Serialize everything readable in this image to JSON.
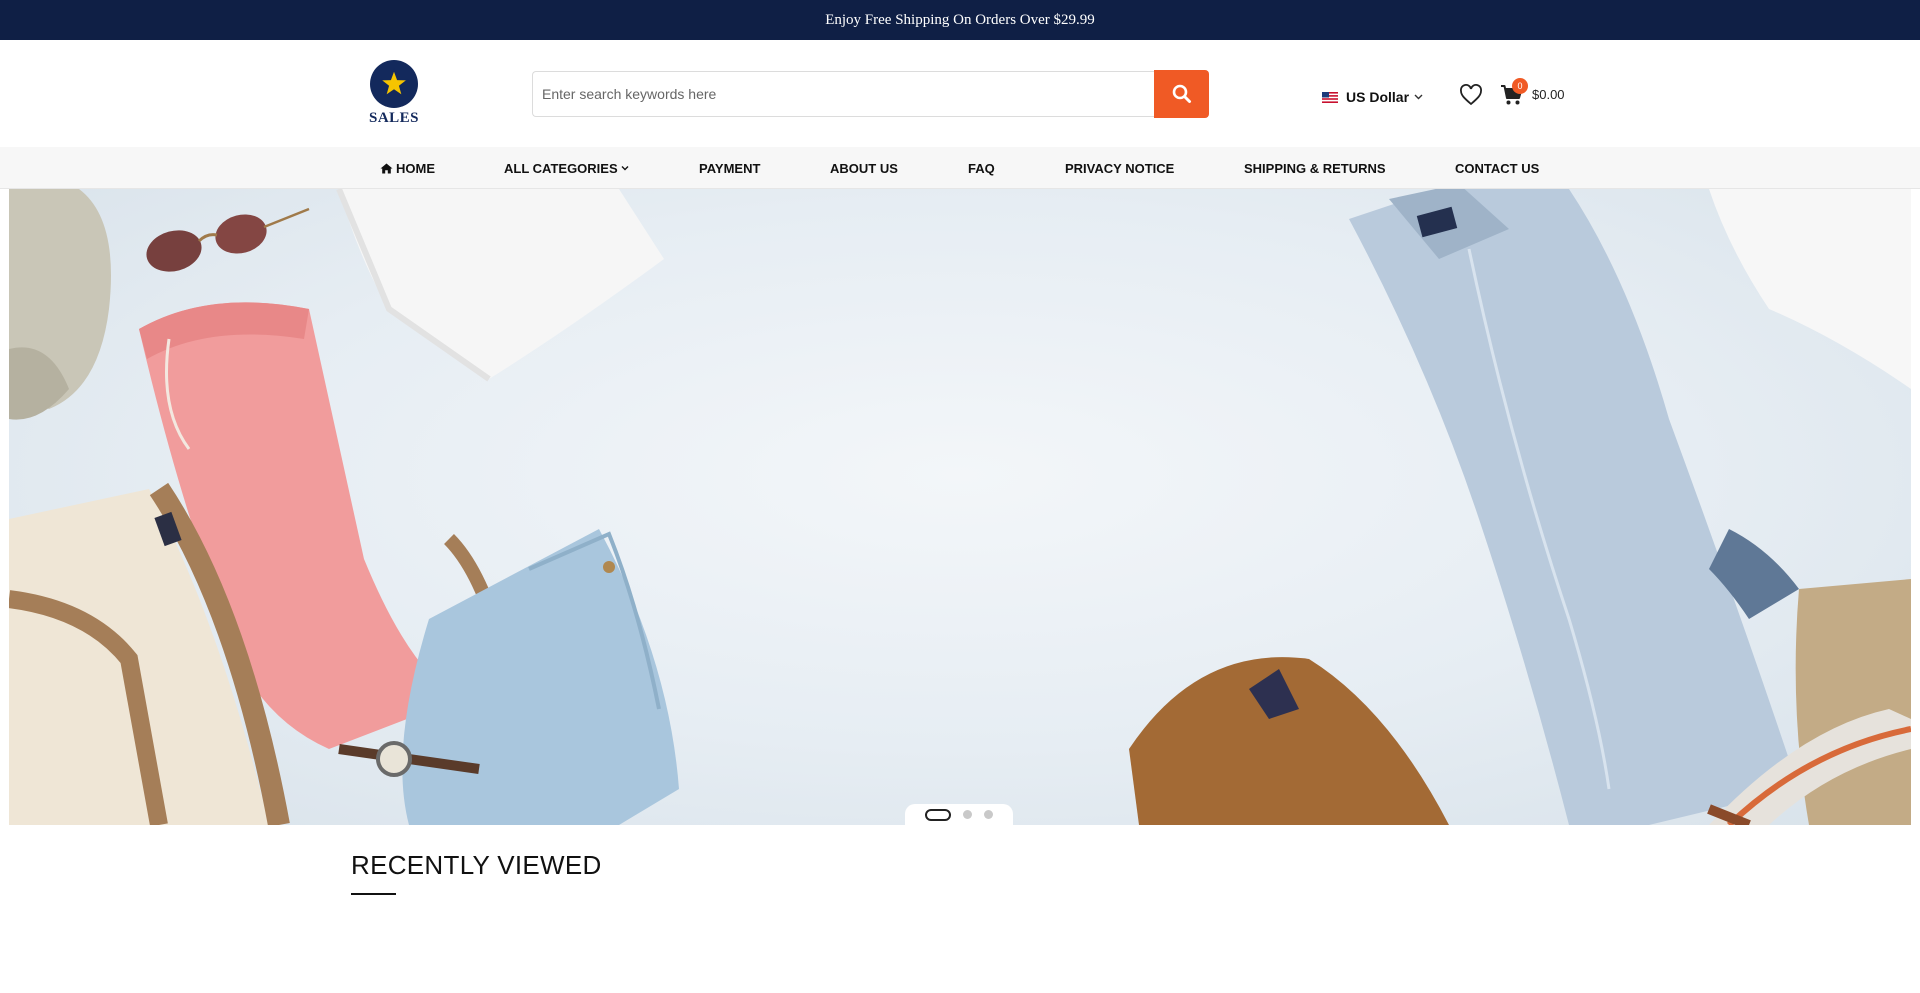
{
  "topbar": {
    "text": "Enjoy Free Shipping On Orders Over $29.99"
  },
  "logo": {
    "text": "SALES"
  },
  "search": {
    "placeholder": "Enter search keywords here"
  },
  "currency": {
    "label": "US Dollar",
    "flag_icon": "us-flag-icon"
  },
  "cart": {
    "count": "0",
    "total": "$0.00"
  },
  "nav": {
    "home": "HOME",
    "categories": "ALL CATEGORIES",
    "payment": "PAYMENT",
    "about": "ABOUT US",
    "faq": "FAQ",
    "privacy": "PRIVACY NOTICE",
    "shipping": "SHIPPING & RETURNS",
    "contact": "CONTACT US"
  },
  "carousel": {
    "slides": 3,
    "active_slide": 1
  },
  "recently_viewed": {
    "title": "RECENTLY VIEWED"
  },
  "colors": {
    "topbar": "#0f1f45",
    "accent": "#f05a25",
    "logo": "#13295c",
    "star": "#f5c400"
  }
}
